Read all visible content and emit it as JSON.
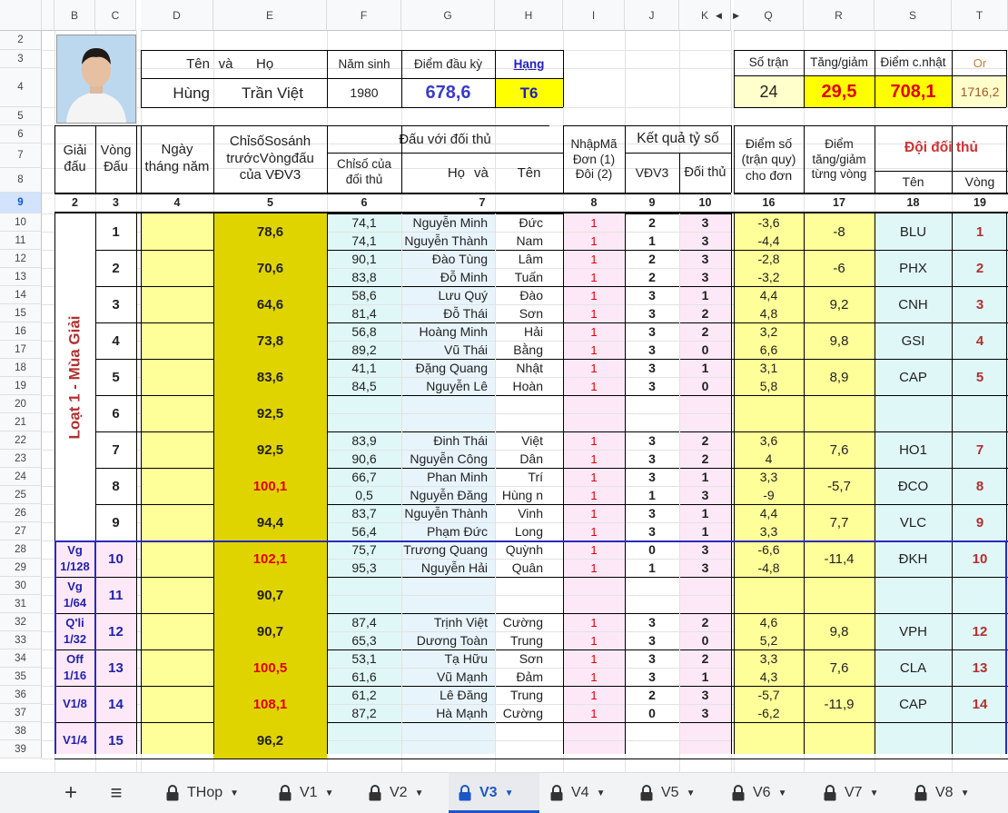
{
  "column_headers": [
    "B",
    "C",
    "D",
    "E",
    "F",
    "G",
    "H",
    "I",
    "J",
    "K",
    "Q",
    "R",
    "S",
    "T"
  ],
  "header_rows": [
    "2",
    "3",
    "4",
    "5",
    "6",
    "7",
    "8"
  ],
  "selected_row": "9",
  "player": {
    "label_ten": "Tên",
    "label_va": "và",
    "label_ho": "Họ",
    "first_name": "Hùng",
    "last_name": "Trần Việt",
    "label_birth": "Năm sinh",
    "birth_year": "1980",
    "label_start": "Điểm đầu kỳ",
    "start_score": "678,6",
    "label_rank": "Hạng",
    "rank": "T6"
  },
  "summary": {
    "label_matches": "Số trận",
    "matches": "24",
    "label_delta": "Tăng/giảm",
    "delta": "29,5",
    "label_updated": "Điểm c.nhật",
    "updated": "708,1",
    "label_or": "Or",
    "or_value": "1716,2"
  },
  "table_headers": {
    "giai": "Giải đấu",
    "vong": "Vòng Đấu",
    "ngay": "Ngày tháng năm",
    "chiso": "ChỉsốSosánh trướcVòngđấu của VĐV3",
    "dau_voi": "Đấu với đối thủ",
    "chiso_doithu": "Chỉsố của đối thủ",
    "ho": "Họ",
    "va": "và",
    "ten": "Tên",
    "nhap_ma": "NhậpMã Đơn (1) Đôi (2)",
    "ketqua": "Kết quả tỷ số",
    "vdv3": "VĐV3",
    "doi_thu": "Đối thủ",
    "diem_so": "Điểm số (trận quy) cho đơn",
    "diem_tang": "Điểm tăng/giảm từng vòng",
    "doi_doi_thu": "Đội đối thủ",
    "doi_ten": "Tên",
    "doi_vong": "Vòng"
  },
  "col_numbers": [
    "2",
    "3",
    "4",
    "5",
    "6",
    "7",
    "8",
    "9",
    "10",
    "16",
    "17",
    "18",
    "19"
  ],
  "sections": [
    {
      "label": "Loạt 1 - Mùa Giải",
      "start": 0,
      "rounds": 9,
      "vertical": true
    },
    {
      "label": "Vg 1/128",
      "start": 9,
      "rounds": 1
    },
    {
      "label": "Vg 1/64",
      "start": 10,
      "rounds": 1
    },
    {
      "label": "Q'li 1/32",
      "start": 11,
      "rounds": 1
    },
    {
      "label": "Off 1/16",
      "start": 12,
      "rounds": 1
    },
    {
      "label": "V1/8",
      "start": 13,
      "rounds": 1
    },
    {
      "label": "V1/4",
      "start": 14,
      "rounds": 1
    }
  ],
  "rounds": [
    {
      "round": "1",
      "index": "78,6",
      "delta": "-8",
      "team": "BLU",
      "team_round": "1",
      "matches": [
        {
          "opp_index": "74,1",
          "surname": "Nguyễn Minh",
          "given": "Đức",
          "type": "1",
          "s1": "2",
          "s2": "3",
          "pts": "-3,6"
        },
        {
          "opp_index": "74,1",
          "surname": "Nguyễn Thành",
          "given": "Nam",
          "type": "1",
          "s1": "1",
          "s2": "3",
          "pts": "-4,4"
        }
      ]
    },
    {
      "round": "2",
      "index": "70,6",
      "delta": "-6",
      "team": "PHX",
      "team_round": "2",
      "matches": [
        {
          "opp_index": "90,1",
          "surname": "Đào Tùng",
          "given": "Lâm",
          "type": "1",
          "s1": "2",
          "s2": "3",
          "pts": "-2,8"
        },
        {
          "opp_index": "83,8",
          "surname": "Đỗ Minh",
          "given": "Tuấn",
          "type": "1",
          "s1": "2",
          "s2": "3",
          "pts": "-3,2"
        }
      ]
    },
    {
      "round": "3",
      "index": "64,6",
      "delta": "9,2",
      "team": "CNH",
      "team_round": "3",
      "matches": [
        {
          "opp_index": "58,6",
          "surname": "Lưu Quý",
          "given": "Đào",
          "type": "1",
          "s1": "3",
          "s2": "1",
          "pts": "4,4"
        },
        {
          "opp_index": "81,4",
          "surname": "Đỗ Thái",
          "given": "Sơn",
          "type": "1",
          "s1": "3",
          "s2": "2",
          "pts": "4,8"
        }
      ]
    },
    {
      "round": "4",
      "index": "73,8",
      "delta": "9,8",
      "team": "GSI",
      "team_round": "4",
      "matches": [
        {
          "opp_index": "56,8",
          "surname": "Hoàng Minh",
          "given": "Hải",
          "type": "1",
          "s1": "3",
          "s2": "2",
          "pts": "3,2"
        },
        {
          "opp_index": "89,2",
          "surname": "Vũ Thái",
          "given": "Bằng",
          "type": "1",
          "s1": "3",
          "s2": "0",
          "pts": "6,6"
        }
      ]
    },
    {
      "round": "5",
      "index": "83,6",
      "delta": "8,9",
      "team": "CAP",
      "team_round": "5",
      "matches": [
        {
          "opp_index": "41,1",
          "surname": "Đặng Quang",
          "given": "Nhật",
          "type": "1",
          "s1": "3",
          "s2": "1",
          "pts": "3,1"
        },
        {
          "opp_index": "84,5",
          "surname": "Nguyễn Lê",
          "given": "Hoàn",
          "type": "1",
          "s1": "3",
          "s2": "0",
          "pts": "5,8"
        }
      ]
    },
    {
      "round": "6",
      "index": "92,5",
      "delta": "",
      "team": "",
      "team_round": "",
      "matches": []
    },
    {
      "round": "7",
      "index": "92,5",
      "delta": "7,6",
      "team": "HO1",
      "team_round": "7",
      "matches": [
        {
          "opp_index": "83,9",
          "surname": "Đinh Thái",
          "given": "Việt",
          "type": "1",
          "s1": "3",
          "s2": "2",
          "pts": "3,6"
        },
        {
          "opp_index": "90,6",
          "surname": "Nguyễn Công",
          "given": "Dân",
          "type": "1",
          "s1": "3",
          "s2": "2",
          "pts": "4"
        }
      ]
    },
    {
      "round": "8",
      "index": "100,1",
      "index_red": true,
      "delta": "-5,7",
      "team": "ĐCO",
      "team_round": "8",
      "matches": [
        {
          "opp_index": "66,7",
          "surname": "Phan Minh",
          "given": "Trí",
          "type": "1",
          "s1": "3",
          "s2": "1",
          "pts": "3,3"
        },
        {
          "opp_index": "0,5",
          "surname": "Nguyễn Đăng",
          "given": "Hùng n",
          "type": "1",
          "s1": "1",
          "s2": "3",
          "pts": "-9"
        }
      ]
    },
    {
      "round": "9",
      "index": "94,4",
      "delta": "7,7",
      "team": "VLC",
      "team_round": "9",
      "matches": [
        {
          "opp_index": "83,7",
          "surname": "Nguyễn Thành",
          "given": "Vinh",
          "type": "1",
          "s1": "3",
          "s2": "1",
          "pts": "4,4"
        },
        {
          "opp_index": "56,4",
          "surname": "Phạm Đức",
          "given": "Long",
          "type": "1",
          "s1": "3",
          "s2": "1",
          "pts": "3,3"
        }
      ]
    },
    {
      "round": "10",
      "index": "102,1",
      "index_red": true,
      "delta": "-11,4",
      "team": "ĐKH",
      "team_round": "10",
      "matches": [
        {
          "opp_index": "75,7",
          "surname": "Trương Quang",
          "given": "Quỳnh",
          "type": "1",
          "s1": "0",
          "s2": "3",
          "pts": "-6,6"
        },
        {
          "opp_index": "95,3",
          "surname": "Nguyễn Hải",
          "given": "Quân",
          "type": "1",
          "s1": "1",
          "s2": "3",
          "pts": "-4,8"
        }
      ]
    },
    {
      "round": "11",
      "index": "90,7",
      "delta": "",
      "team": "",
      "team_round": "",
      "matches": []
    },
    {
      "round": "12",
      "index": "90,7",
      "delta": "9,8",
      "team": "VPH",
      "team_round": "12",
      "matches": [
        {
          "opp_index": "87,4",
          "surname": "Trịnh Việt",
          "given": "Cường",
          "type": "1",
          "s1": "3",
          "s2": "2",
          "pts": "4,6"
        },
        {
          "opp_index": "65,3",
          "surname": "Dương Toàn",
          "given": "Trung",
          "type": "1",
          "s1": "3",
          "s2": "0",
          "pts": "5,2"
        }
      ]
    },
    {
      "round": "13",
      "index": "100,5",
      "index_red": true,
      "delta": "7,6",
      "team": "CLA",
      "team_round": "13",
      "matches": [
        {
          "opp_index": "53,1",
          "surname": "Tạ Hữu",
          "given": "Sơn",
          "type": "1",
          "s1": "3",
          "s2": "2",
          "pts": "3,3"
        },
        {
          "opp_index": "61,6",
          "surname": "Vũ Mạnh",
          "given": "Đảm",
          "type": "1",
          "s1": "3",
          "s2": "1",
          "pts": "4,3"
        }
      ]
    },
    {
      "round": "14",
      "index": "108,1",
      "index_red": true,
      "delta": "-11,9",
      "team": "CAP",
      "team_round": "14",
      "matches": [
        {
          "opp_index": "61,2",
          "surname": "Lê Đăng",
          "given": "Trung",
          "type": "1",
          "s1": "2",
          "s2": "3",
          "pts": "-5,7"
        },
        {
          "opp_index": "87,2",
          "surname": "Hà Mạnh",
          "given": "Cường",
          "type": "1",
          "s1": "0",
          "s2": "3",
          "pts": "-6,2"
        }
      ]
    },
    {
      "round": "15",
      "index": "96,2",
      "delta": "",
      "team": "",
      "team_round": "",
      "matches": []
    }
  ],
  "tabs": [
    {
      "label": "THop",
      "active": false
    },
    {
      "label": "V1",
      "active": false
    },
    {
      "label": "V2",
      "active": false
    },
    {
      "label": "V3",
      "active": true
    },
    {
      "label": "V4",
      "active": false
    },
    {
      "label": "V5",
      "active": false
    },
    {
      "label": "V6",
      "active": false
    },
    {
      "label": "V7",
      "active": false
    },
    {
      "label": "V8",
      "active": false
    }
  ],
  "icons": {
    "add_sheet": "plus-icon",
    "all_sheets": "menu-icon",
    "tab_lock": "lock-icon",
    "tab_menu": "caret-down-icon",
    "hidden_cols": "hidden-columns-arrows-icon"
  },
  "colors": {
    "yellow": "#ffff99",
    "olive": "#e0d400",
    "cyan": "#e0f7f7",
    "pink": "#fde8f7",
    "blue_text": "#3a3acc",
    "red_text": "#e00000",
    "rank_text": "#2020c0",
    "section_red": "#b03030",
    "light_blue": "#e8f4fb"
  }
}
